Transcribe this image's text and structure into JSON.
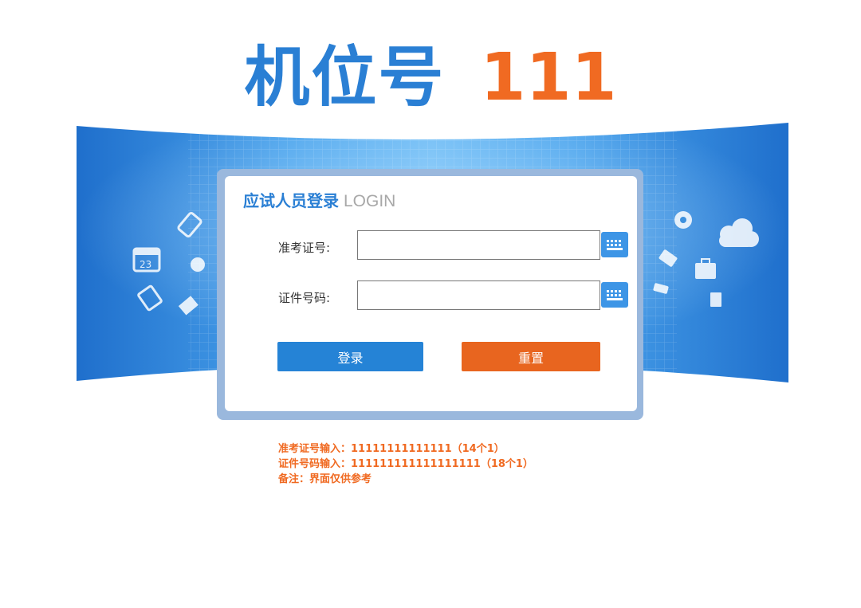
{
  "header": {
    "seat_label": "机位号",
    "seat_number": "111"
  },
  "login": {
    "title_cn": "应试人员登录",
    "title_en": "LOGIN",
    "fields": [
      {
        "label": "准考证号:",
        "value": "",
        "placeholder": ""
      },
      {
        "label": "证件号码:",
        "value": "",
        "placeholder": ""
      }
    ],
    "keyboard_icon": "keyboard-icon",
    "login_button": "登录",
    "reset_button": "重置"
  },
  "notes": {
    "line1": "准考证号输入：11111111111111（14个1）",
    "line2": "证件号码输入：111111111111111111（18个1）",
    "line3": "备注：界面仅供参考"
  },
  "colors": {
    "brand_blue": "#2a7fd4",
    "accent_orange": "#f06a22",
    "button_blue": "#2583d6",
    "button_orange": "#e8651f",
    "banner_blue": "#1f74cf"
  },
  "banner_icons": [
    "calendar-icon",
    "phone-icon",
    "globe-icon",
    "clipboard-icon",
    "mail-icon",
    "gear-icon",
    "cloud-icon",
    "tag-icon",
    "briefcase-icon",
    "contact-book-icon"
  ]
}
